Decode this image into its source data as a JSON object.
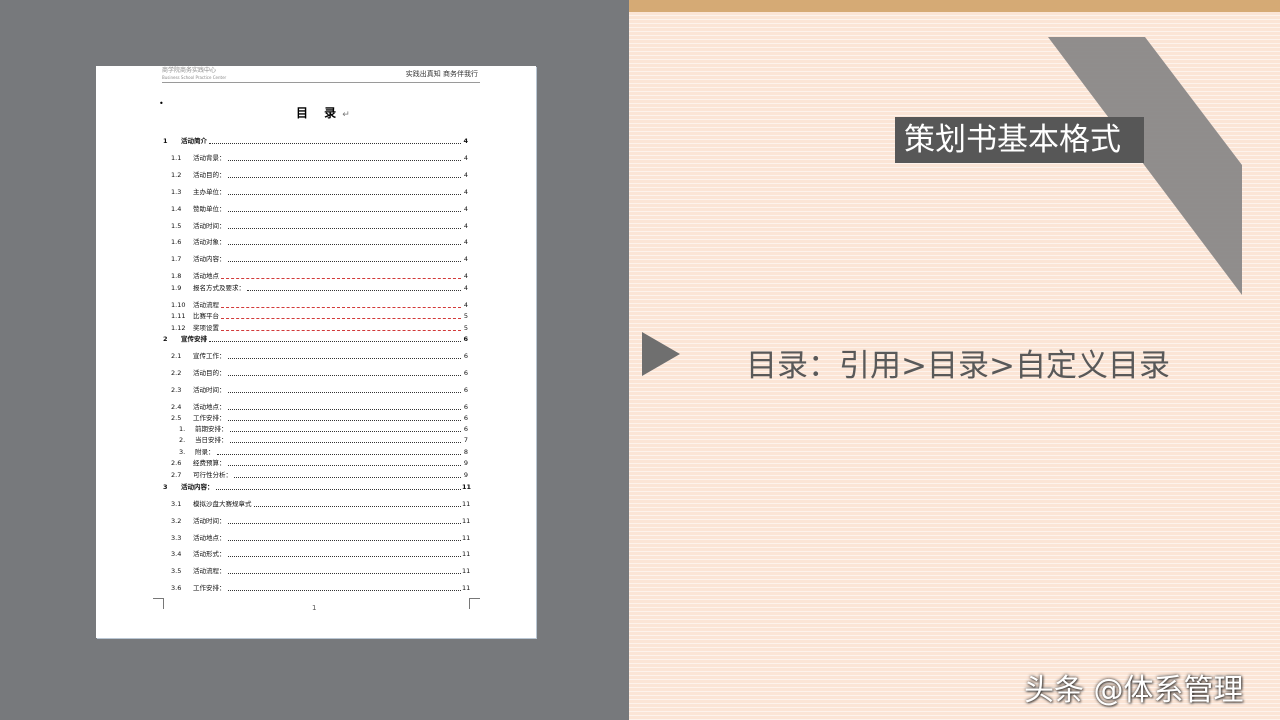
{
  "slide": {
    "title": "策划书基本格式",
    "instruction": "目录：引用>目录>自定义目录",
    "watermark": "头条 @体系管理",
    "colors": {
      "left_panel": "#77797c",
      "right_panel": "#fbe5d6",
      "top_band": "#d5aa75",
      "title_box": "#575757",
      "text": "#595959"
    }
  },
  "document": {
    "header_logo": "商学院商务实践中心",
    "header_logo_sub": "Business School Practice Center",
    "header_motto": "实践出真知  商务伴我行",
    "title": "目  录",
    "page_number": "1",
    "toc": [
      {
        "num": "1",
        "label": "活动简介",
        "page": "4",
        "level": 1
      },
      {
        "num": "1.1",
        "label": "活动背景：",
        "page": "4",
        "level": 2
      },
      {
        "num": "1.2",
        "label": "活动目的：",
        "page": "4",
        "level": 2
      },
      {
        "num": "1.3",
        "label": "主办单位：",
        "page": "4",
        "level": 2
      },
      {
        "num": "1.4",
        "label": "赞助单位：",
        "page": "4",
        "level": 2
      },
      {
        "num": "1.5",
        "label": "活动时间：",
        "page": "4",
        "level": 2
      },
      {
        "num": "1.6",
        "label": "活动对象：",
        "page": "4",
        "level": 2
      },
      {
        "num": "1.7",
        "label": "活动内容：",
        "page": "4",
        "level": 2
      },
      {
        "num": "1.8",
        "label": "活动地点",
        "page": "4",
        "level": 2,
        "wavy": true
      },
      {
        "num": "1.9",
        "label": "报名方式及要求：",
        "page": "4",
        "level": 2
      },
      {
        "num": "1.10",
        "label": "活动流程",
        "page": "4",
        "level": 2,
        "wavy": true
      },
      {
        "num": "1.11",
        "label": "比赛平台",
        "page": "5",
        "level": 2,
        "wavy": true
      },
      {
        "num": "1.12",
        "label": "奖项设置",
        "page": "5",
        "level": 2,
        "wavy": true
      },
      {
        "num": "2",
        "label": "宣传安排",
        "page": "6",
        "level": 1
      },
      {
        "num": "2.1",
        "label": "宣传工作：",
        "page": "6",
        "level": 2
      },
      {
        "num": "2.2",
        "label": "活动目的：",
        "page": "6",
        "level": 2
      },
      {
        "num": "2.3",
        "label": "活动时间：",
        "page": "6",
        "level": 2
      },
      {
        "num": "2.4",
        "label": "活动地点：",
        "page": "6",
        "level": 2
      },
      {
        "num": "2.5",
        "label": "工作安排：",
        "page": "6",
        "level": 2
      },
      {
        "num": "1.",
        "label": "前期安排：",
        "page": "6",
        "level": 3
      },
      {
        "num": "2.",
        "label": "当日安排：",
        "page": "7",
        "level": 3
      },
      {
        "num": "3.",
        "label": "附录：",
        "page": "8",
        "level": 3
      },
      {
        "num": "2.6",
        "label": "经费预算：",
        "page": "9",
        "level": 2
      },
      {
        "num": "2.7",
        "label": "可行性分析：",
        "page": "9",
        "level": 2
      },
      {
        "num": "3",
        "label": "活动内容：",
        "page": "11",
        "level": 1
      },
      {
        "num": "3.1",
        "label": "模拟沙盘大赛规章式",
        "page": "11",
        "level": 2
      },
      {
        "num": "3.2",
        "label": "活动时间：",
        "page": "11",
        "level": 2
      },
      {
        "num": "3.3",
        "label": "活动地点：",
        "page": "11",
        "level": 2
      },
      {
        "num": "3.4",
        "label": "活动形式：",
        "page": "11",
        "level": 2
      },
      {
        "num": "3.5",
        "label": "活动流程：",
        "page": "11",
        "level": 2
      },
      {
        "num": "3.6",
        "label": "工作安排：",
        "page": "11",
        "level": 2
      }
    ]
  }
}
